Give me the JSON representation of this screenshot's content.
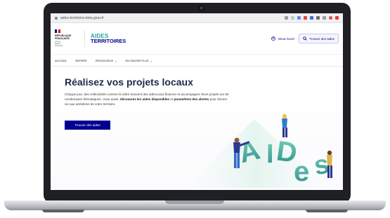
{
  "browser": {
    "url": "aides-territoires.beta.gouv.fr"
  },
  "header": {
    "republic_text": "RÉPUBLIQUE\nFRANÇAISE",
    "motto": "Liberté\nÉgalité\nFraternité",
    "brand_line1": "AIDES",
    "brand_line2": "TERRITOIRES",
    "user_link": "Alexa Guzzi",
    "find_button": "Trouver des aides"
  },
  "nav": {
    "items": [
      {
        "label": "ACCUEIL",
        "has_caret": false
      },
      {
        "label": "REPERE",
        "has_caret": false
      },
      {
        "label": "RESSOURCE",
        "has_caret": true
      },
      {
        "label": "EN SAVOIR PLUS",
        "has_caret": true
      }
    ]
  },
  "hero": {
    "title": "Réalisez vos projets locaux",
    "desc_part1": "Chaque jour, des collectivités comme la vôtre trouvent des aides pour financer et accompagner leurs projets sur de nombreuses thématiques. Vous aussi, ",
    "desc_bold1": "découvrez les aides disponibles",
    "desc_part2": " et ",
    "desc_bold2": "paramétrez des alertes",
    "desc_part3": " pour donner vie aux ambitions de votre territoire.",
    "cta": "Trouver des aides",
    "illustration_letters": [
      "A",
      "I",
      "D",
      "e",
      "s"
    ]
  },
  "colors": {
    "primary": "#000091",
    "accent": "#27a3a3",
    "brand_gradient_start": "#6cc7b0",
    "brand_gradient_end": "#2c8e8f"
  }
}
